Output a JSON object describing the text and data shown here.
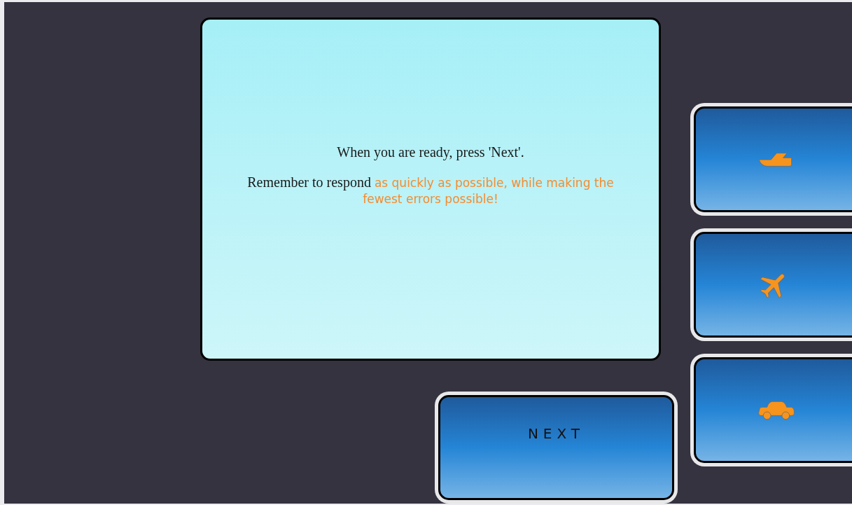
{
  "message": {
    "line_1": "When you are ready, press 'Next'.",
    "line_2": {
      "text": "Remember to respond",
      "emphasis": "as quickly as possible, while making the fewest errors possible!"
    }
  },
  "choices": [
    {
      "kind": "boat"
    },
    {
      "kind": "plane"
    },
    {
      "kind": "car"
    }
  ],
  "next_button": {
    "label": "NEXT"
  }
}
